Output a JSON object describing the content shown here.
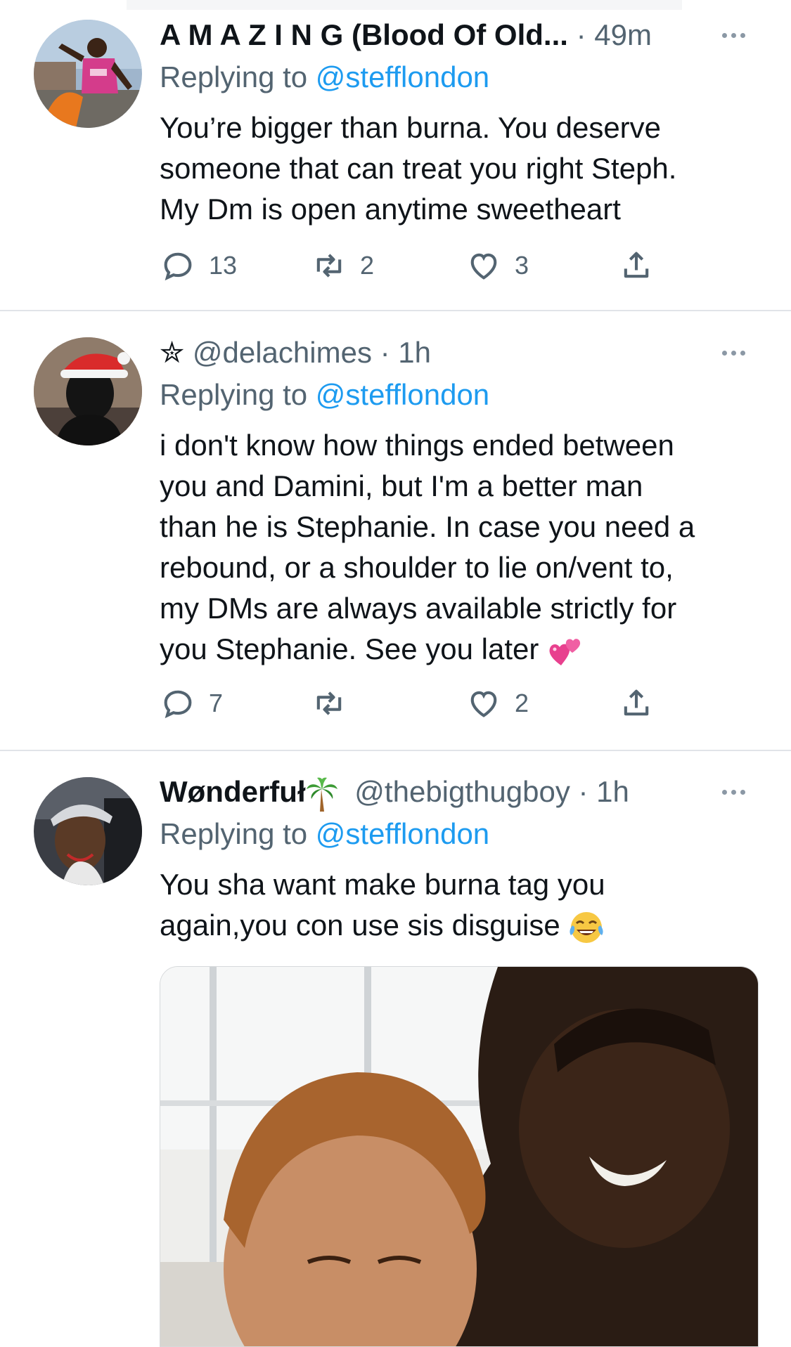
{
  "tweets": [
    {
      "display_name": "A M A Z I N G (Blood Of Old...",
      "handle": "",
      "time": "49m",
      "replying_prefix": "Replying to",
      "replying_to": "@stefflondon",
      "lines": [
        "You’re bigger than burna. You deserve",
        "someone that can treat you right Steph.",
        "My Dm is open anytime sweetheart"
      ],
      "reply_count": "13",
      "retweet_count": "2",
      "like_count": "3"
    },
    {
      "display_name": "✮",
      "handle": "@delachimes",
      "time": "1h",
      "replying_prefix": "Replying to",
      "replying_to": "@stefflondon",
      "lines": [
        "i don't know how things ended between",
        "you and Damini, but I'm a better man",
        "than he is Stephanie. In case you need a",
        "rebound, or a shoulder to lie on/vent to,",
        "my DMs are always available strictly for",
        "you Stephanie. See you later"
      ],
      "reply_count": "7",
      "retweet_count": "",
      "like_count": "2"
    },
    {
      "display_name": "Wønderfuł",
      "handle": "@thebigthugboy",
      "time": "1h",
      "replying_prefix": "Replying to",
      "replying_to": "@stefflondon",
      "lines": [
        "You sha want make burna tag you",
        "again,you con use sis disguise"
      ],
      "reply_count": "",
      "retweet_count": "",
      "like_count": ""
    }
  ],
  "dot": "·",
  "icons": {
    "more": "more-horizontal-icon",
    "reply": "reply-bubble-icon",
    "retweet": "retweet-icon",
    "like": "heart-icon",
    "share": "share-upload-icon",
    "emoji_hearts": "two-hearts-emoji",
    "emoji_laugh": "tears-of-joy-emoji",
    "emoji_palm": "palm-tree-emoji"
  },
  "colors": {
    "link": "#1d9bf0",
    "secondary": "#536471",
    "text": "#0f1419"
  }
}
